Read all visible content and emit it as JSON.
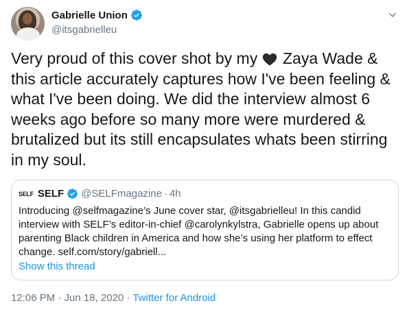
{
  "author": {
    "name": "Gabrielle Union",
    "handle": "@itsgabrielleu"
  },
  "tweet": {
    "text_before_emoji": "Very proud of this cover shot by my ",
    "emoji_icon": "black-heart-icon",
    "text_after_emoji": " Zaya Wade & this article  accurately captures how I've been feeling & what I've been doing. We did the interview almost 6 weeks ago before so many more were murdered & brutalized but its still encapsulates whats been stirring in my soul."
  },
  "quoted": {
    "logo_text": "SELF",
    "name": "SELF",
    "handle": "@SELFmagazine",
    "separator": "·",
    "time": "4h",
    "text": "Introducing @selfmagazine’s June cover star, @itsgabrielleu! In this candid interview with SELF’s editor-in-chief @carolynkylstra, Gabrielle opens up about parenting Black children in America and how she’s using her platform to effect change. self.com/story/gabriell...",
    "show_thread": "Show this thread"
  },
  "meta": {
    "timestamp": "12:06 PM · Jun 18, 2020",
    "separator": " · ",
    "source": "Twitter for Android"
  },
  "colors": {
    "link": "#1b95e0",
    "secondary_text": "#657786",
    "verified": "#1da1f2"
  }
}
